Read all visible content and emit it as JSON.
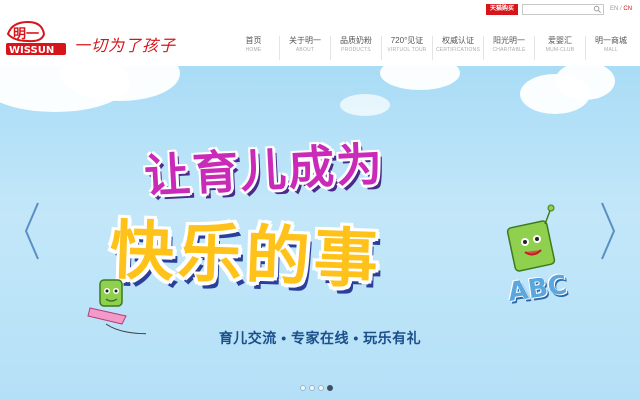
{
  "brand": {
    "logo_cn": "明一",
    "logo_en": "WISSUN",
    "slogan": "一切为了孩子"
  },
  "topbar": {
    "tmall_label": "天猫购买",
    "search_placeholder": "",
    "lang_en": "EN",
    "lang_sep": "/",
    "lang_cn": "CN"
  },
  "nav": [
    {
      "cn": "首页",
      "en": "HOME"
    },
    {
      "cn": "关于明一",
      "en": "ABOUT"
    },
    {
      "cn": "品质奶粉",
      "en": "PRODUCTS"
    },
    {
      "cn": "720°见证",
      "en": "VIRTUOL TOUR"
    },
    {
      "cn": "权威认证",
      "en": "CERTIFICATIONS"
    },
    {
      "cn": "阳光明一",
      "en": "CHARITABLE"
    },
    {
      "cn": "爱婴汇",
      "en": "MUM-CLUB"
    },
    {
      "cn": "明一商城",
      "en": "MALL"
    }
  ],
  "banner": {
    "headline_1": "让育儿成为",
    "headline_2": "快乐的事",
    "subline": "育儿交流 • 专家在线 • 玩乐有礼",
    "abc": "ABC",
    "slide_count": 4,
    "active_slide": 4
  },
  "colors": {
    "brand_red": "#d8141b",
    "sky": "#b4e0f7",
    "headline_pink": "#c92ab8",
    "headline_yellow": "#ffc21a"
  }
}
